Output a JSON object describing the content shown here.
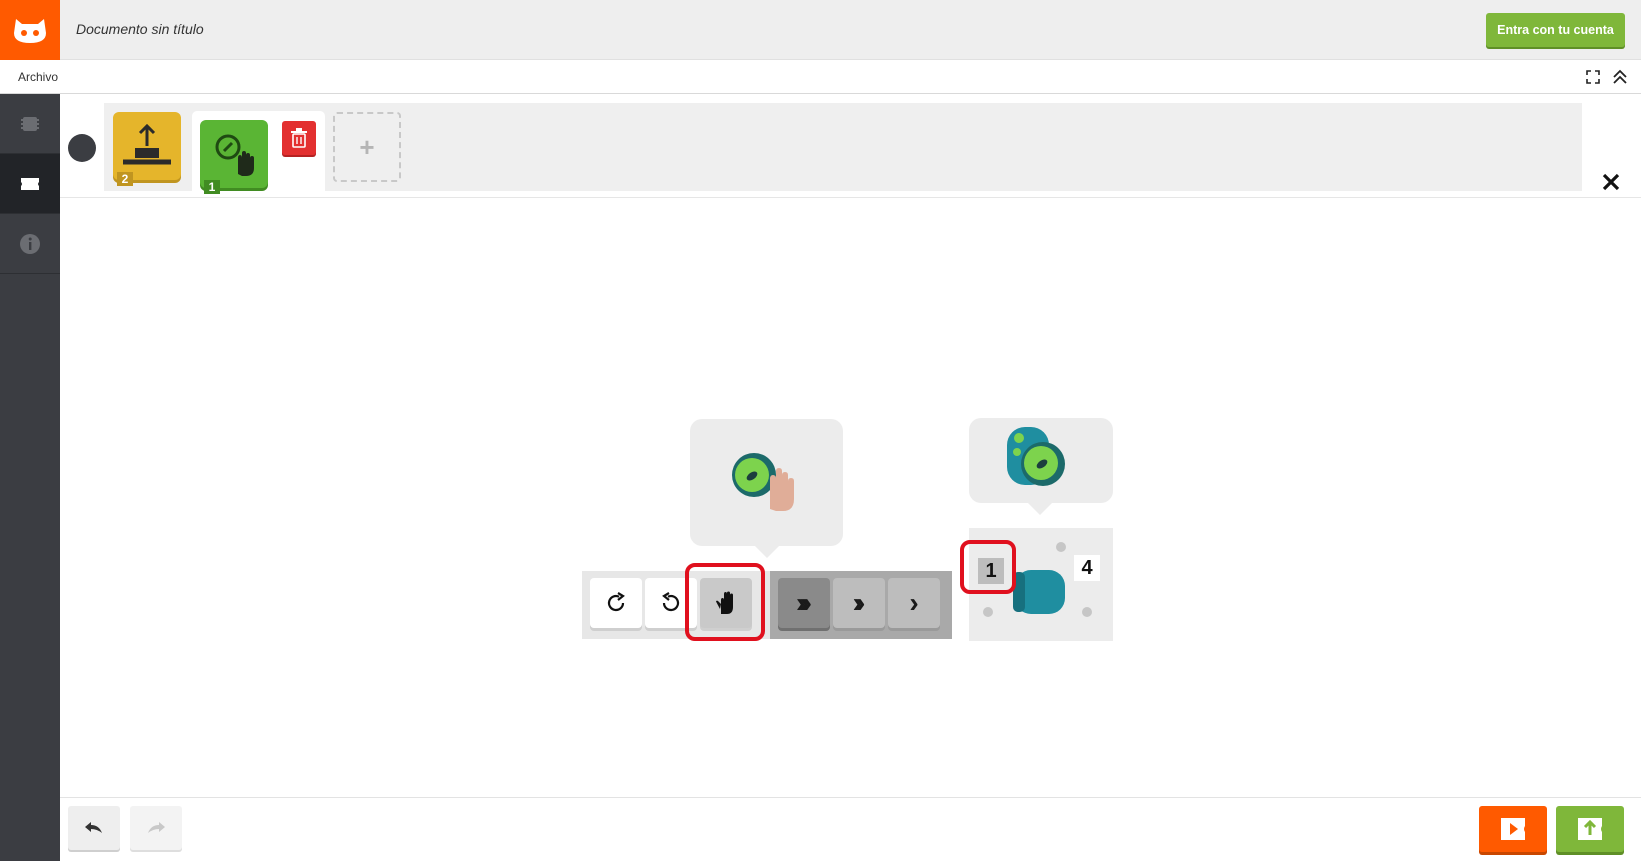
{
  "header": {
    "document_title": "Documento sin título",
    "login_label": "Entra con tu cuenta",
    "brand_color": "#ff5a00",
    "login_color": "#7fb73a"
  },
  "menubar": {
    "file_label": "Archivo",
    "icons": [
      "fullscreen-icon",
      "collapse-up-icon"
    ]
  },
  "sidebar": {
    "items": [
      {
        "name": "hardware",
        "icon": "chip-icon",
        "active": false
      },
      {
        "name": "software",
        "icon": "puzzle-icon",
        "active": true
      },
      {
        "name": "info",
        "icon": "info-icon",
        "active": false
      }
    ]
  },
  "program": {
    "blocks": [
      {
        "name": "upload-block",
        "icon": "upload-arrow-icon",
        "color": "#e5b52b",
        "number": "2"
      },
      {
        "name": "rotate-block",
        "icon": "compass-hand-icon",
        "color": "#5ab534",
        "number": "1",
        "selected": true
      }
    ],
    "add_block_symbol": "+"
  },
  "editor": {
    "action_buttons": [
      {
        "name": "rotate-clockwise",
        "icon": "rotate-cw-icon"
      },
      {
        "name": "rotate-counterclockwise",
        "icon": "rotate-ccw-icon"
      },
      {
        "name": "stop-hand",
        "icon": "hand-icon",
        "selected": true
      }
    ],
    "speed_buttons": [
      {
        "name": "speed-fast",
        "symbol": "›››",
        "selected": true
      },
      {
        "name": "speed-medium",
        "symbol": "››"
      },
      {
        "name": "speed-slow",
        "symbol": "›"
      }
    ],
    "field": {
      "start_number": "1",
      "target_number": "4"
    },
    "highlight_color": "#e0101e"
  },
  "footer": {
    "buttons": [
      "undo-icon",
      "redo-icon",
      "run-icon",
      "upload-icon"
    ]
  }
}
